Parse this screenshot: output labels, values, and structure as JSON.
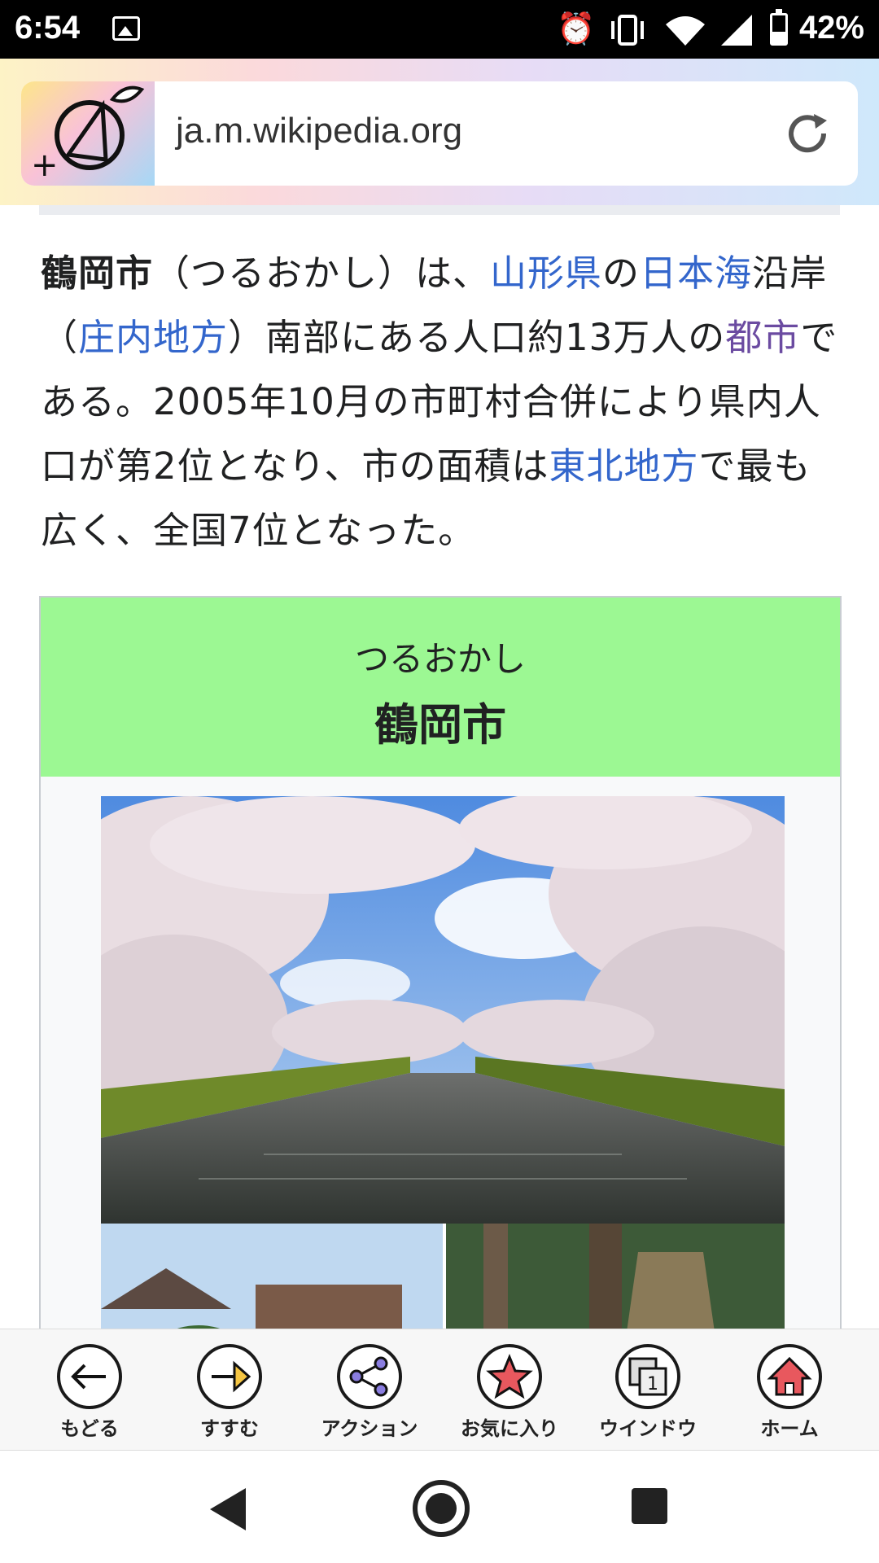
{
  "status": {
    "time": "6:54",
    "battery": "42%"
  },
  "browser": {
    "url": "ja.m.wikipedia.org"
  },
  "article": {
    "intro": {
      "t0": "鶴岡市",
      "t1": "（つるおかし）は、",
      "l1": "山形県",
      "t2": "の",
      "l2": "日本海",
      "t3": "沿岸（",
      "l3": "庄内地方",
      "t4": "）南部にある人口約13万人の",
      "l4": "都市",
      "t5": "である。2005年10月の市町村合併により県内人口が第2位となり、市の面積は",
      "l5": "東北地方",
      "t6": "で最も広く、全国7位となった。"
    },
    "infobox": {
      "kana": "つるおかし",
      "name": "鶴岡市"
    }
  },
  "toolbar": {
    "back": "もどる",
    "forward": "すすむ",
    "action": "アクション",
    "favorite": "お気に入り",
    "window": "ウインドウ",
    "window_count": "1",
    "home": "ホーム"
  }
}
